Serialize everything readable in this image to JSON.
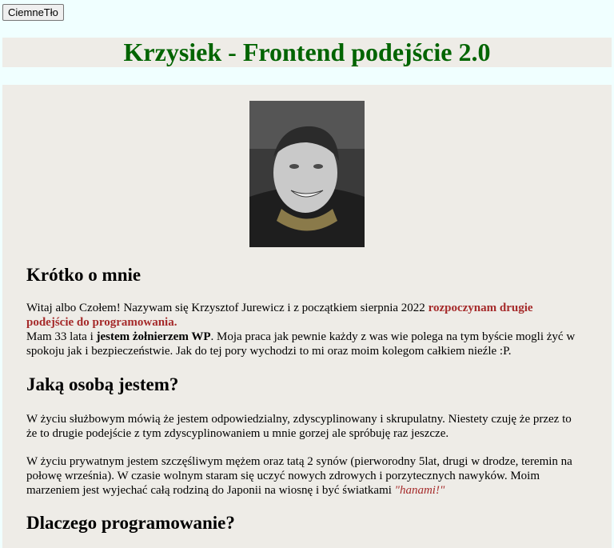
{
  "toolbar": {
    "dark_mode_label": "CiemneTło"
  },
  "header": {
    "title": "Krzysiek - Frontend podejście 2.0"
  },
  "about": {
    "heading": "Krótko o mnie",
    "p1_before": "Witaj albo Czołem! Nazywam się Krzysztof Jurewicz i z początkiem sierpnia 2022 ",
    "p1_highlight": "rozpoczynam drugie podejście do programowania.",
    "p2_before": "Mam 33 lata i ",
    "p2_bold": "jestem żołnierzem WP",
    "p2_after": ". Moja praca jak pewnie każdy z was wie polega na tym byście mogli żyć w spokoju jak i bezpieczeństwie. Jak do tej pory wychodzi to mi oraz moim kolegom całkiem nieźle :P."
  },
  "person": {
    "heading": "Jaką osobą jestem?",
    "p1": "W życiu służbowym mówią że jestem odpowiedzialny, zdyscyplinowany i skrupulatny. Niestety czuję że przez to że to drugie podejście z tym zdyscyplinowaniem u mnie gorzej ale spróbuję raz jeszcze.",
    "p2_before": "W życiu prywatnym jestem szczęśliwym mężem oraz tatą 2 synów (pierworodny 5lat, drugi w drodze, teremin na połowę września). W czasie wolnym staram się uczyć nowych zdrowych i porzytecznych nawyków. Moim marzeniem jest wyjechać całą rodziną do Japonii na wiosnę i być światkami ",
    "p2_quote": "\"hanami!\""
  },
  "why": {
    "heading": "Dlaczego programowanie?"
  },
  "colors": {
    "page_bg": "#f0ffff",
    "section_bg": "#eeece7",
    "title": "#006400",
    "accent": "#a52a2a"
  }
}
